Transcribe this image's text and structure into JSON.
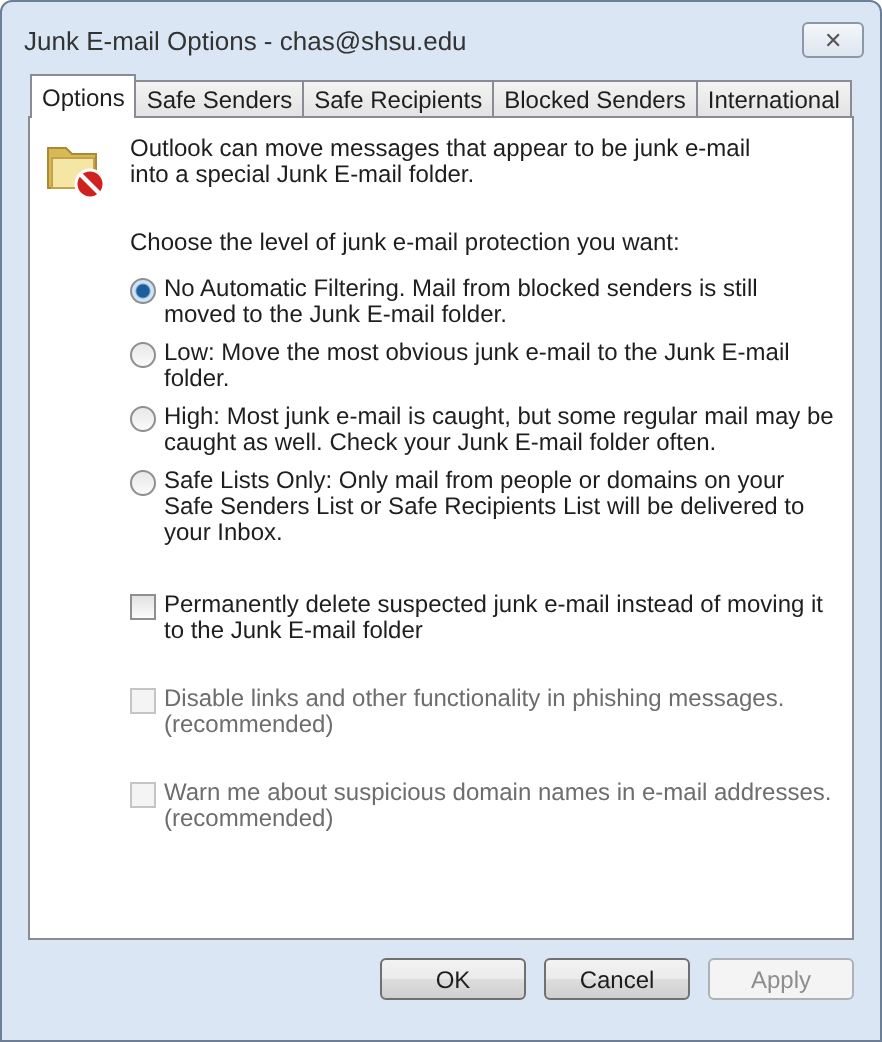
{
  "window": {
    "title": "Junk E-mail Options - chas@shsu.edu",
    "close": "✕"
  },
  "tabs": [
    {
      "label": "Options",
      "selected": true
    },
    {
      "label": "Safe Senders",
      "selected": false
    },
    {
      "label": "Safe Recipients",
      "selected": false
    },
    {
      "label": "Blocked Senders",
      "selected": false
    },
    {
      "label": "International",
      "selected": false
    }
  ],
  "intro": "Outlook can move messages that appear to be junk e-mail into a special Junk E-mail folder.",
  "prompt": "Choose the level of junk e-mail protection you want:",
  "levels": [
    {
      "label": "No Automatic Filtering. Mail from blocked senders is still moved to the Junk E-mail folder.",
      "selected": true
    },
    {
      "label": "Low: Move the most obvious junk e-mail to the Junk E-mail folder.",
      "selected": false
    },
    {
      "label": "High: Most junk e-mail is caught, but some regular mail may be caught as well. Check your Junk E-mail folder often.",
      "selected": false
    },
    {
      "label": "Safe Lists Only: Only mail from people or domains on your Safe Senders List or Safe Recipients List will be delivered to your Inbox.",
      "selected": false
    }
  ],
  "checkboxes": [
    {
      "label": "Permanently delete suspected junk e-mail instead of moving it to the Junk E-mail folder",
      "checked": false,
      "disabled": false
    },
    {
      "label": "Disable links and other functionality in phishing messages. (recommended)",
      "checked": false,
      "disabled": true
    },
    {
      "label": "Warn me about suspicious domain names in e-mail addresses. (recommended)",
      "checked": false,
      "disabled": true
    }
  ],
  "buttons": [
    {
      "label": "OK",
      "disabled": false
    },
    {
      "label": "Cancel",
      "disabled": false
    },
    {
      "label": "Apply",
      "disabled": true
    }
  ]
}
